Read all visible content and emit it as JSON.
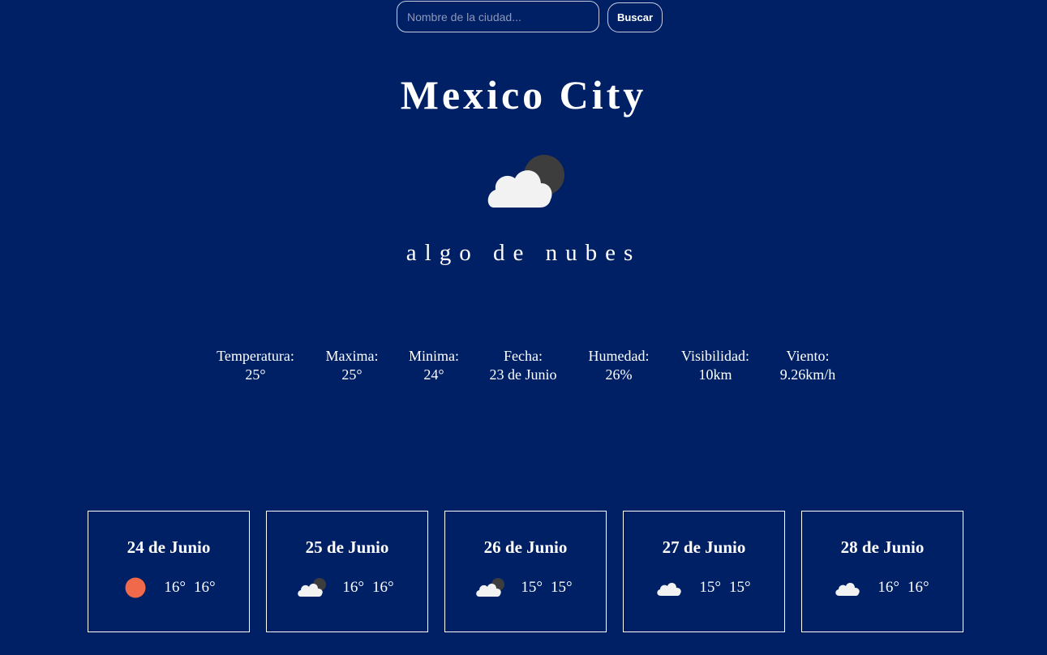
{
  "search": {
    "placeholder": "Nombre de la ciudad...",
    "button_label": "Buscar"
  },
  "city": "Mexico City",
  "current": {
    "icon": "few-clouds-night-icon",
    "description": "algo de nubes"
  },
  "stats": [
    {
      "label": "Temperatura:",
      "value": "25°"
    },
    {
      "label": "Maxima:",
      "value": "25°"
    },
    {
      "label": "Minima:",
      "value": "24°"
    },
    {
      "label": "Fecha:",
      "value": "23 de Junio"
    },
    {
      "label": "Humedad:",
      "value": "26%"
    },
    {
      "label": "Visibilidad:",
      "value": "10km"
    },
    {
      "label": "Viento:",
      "value": "9.26km/h"
    }
  ],
  "forecast": [
    {
      "date": "24 de Junio",
      "icon": "clear-sun-icon",
      "temp_max": "16°",
      "temp_min": "16°"
    },
    {
      "date": "25 de Junio",
      "icon": "few-clouds-night-icon",
      "temp_max": "16°",
      "temp_min": "16°"
    },
    {
      "date": "26 de Junio",
      "icon": "few-clouds-night-icon",
      "temp_max": "15°",
      "temp_min": "15°"
    },
    {
      "date": "27 de Junio",
      "icon": "cloud-icon",
      "temp_max": "15°",
      "temp_min": "15°"
    },
    {
      "date": "28 de Junio",
      "icon": "cloud-icon",
      "temp_max": "16°",
      "temp_min": "16°"
    }
  ],
  "colors": {
    "background": "#002065",
    "text": "#ffffff",
    "sun": "#f0694a",
    "cloud": "#f2f2f2",
    "moon": "#3d3d3d"
  }
}
